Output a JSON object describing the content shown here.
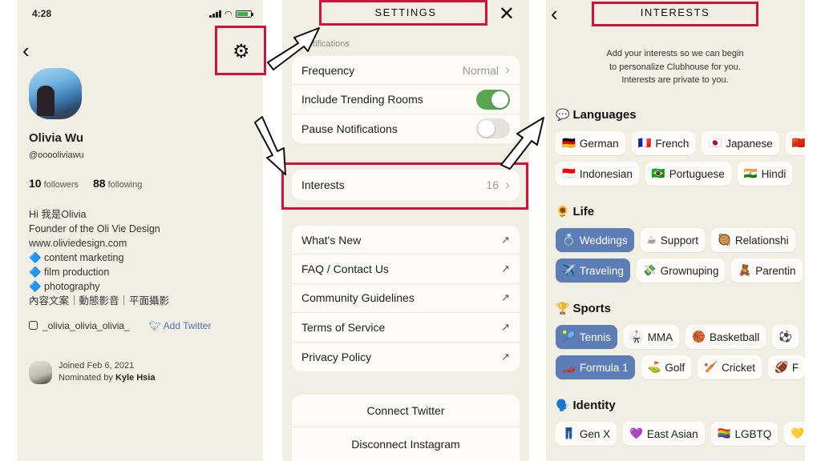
{
  "profile": {
    "status_time": "4:28",
    "name": "Olivia Wu",
    "handle": "@ooooliviawu",
    "followers_count": "10",
    "followers_label": "followers",
    "following_count": "88",
    "following_label": "following",
    "bio": [
      "Hi 我是Olivia",
      "Founder of the Oli Vie Design",
      "www.oliviedesign.com",
      "🔷 content marketing",
      "🔷 film production",
      "🔷 photography",
      "內容文案｜動態影音｜平面攝影"
    ],
    "instagram": "_olivia_olivia_olivia_",
    "add_twitter": "Add Twitter",
    "joined": "Joined Feb 6, 2021",
    "nominated_prefix": "Nominated by",
    "nominated_by": "Kyle Hsia"
  },
  "settings": {
    "title": "SETTINGS",
    "notifications_label": "Notifications",
    "frequency_label": "Frequency",
    "frequency_value": "Normal",
    "trending_label": "Include Trending Rooms",
    "trending_on": true,
    "pause_label": "Pause Notifications",
    "pause_on": false,
    "interests_label": "Interests",
    "interests_count": "16",
    "links": [
      "What's New",
      "FAQ / Contact Us",
      "Community Guidelines",
      "Terms of Service",
      "Privacy Policy"
    ],
    "connect_twitter": "Connect Twitter",
    "disconnect_instagram": "Disconnect Instagram"
  },
  "interests": {
    "title": "INTERESTS",
    "intro": [
      "Add your interests so we can begin",
      "to personalize Clubhouse for you.",
      "Interests are private to you."
    ],
    "categories": [
      {
        "emoji": "💬",
        "name": "Languages",
        "rows": [
          [
            {
              "e": "🇩🇪",
              "t": "German",
              "sel": false
            },
            {
              "e": "🇫🇷",
              "t": "French",
              "sel": false
            },
            {
              "e": "🇯🇵",
              "t": "Japanese",
              "sel": false
            },
            {
              "e": "🇨🇳",
              "t": "",
              "sel": false
            }
          ],
          [
            {
              "e": "🇮🇩",
              "t": "Indonesian",
              "sel": false
            },
            {
              "e": "🇧🇷",
              "t": "Portuguese",
              "sel": false
            },
            {
              "e": "🇮🇳",
              "t": "Hindi",
              "sel": false
            }
          ]
        ]
      },
      {
        "emoji": "🌻",
        "name": "Life",
        "rows": [
          [
            {
              "e": "💍",
              "t": "Weddings",
              "sel": true
            },
            {
              "e": "☕",
              "t": "Support",
              "sel": false
            },
            {
              "e": "🥘",
              "t": "Relationshi",
              "sel": false
            }
          ],
          [
            {
              "e": "✈️",
              "t": "Traveling",
              "sel": true
            },
            {
              "e": "💸",
              "t": "Grownuping",
              "sel": false
            },
            {
              "e": "🧸",
              "t": "Parentin",
              "sel": false
            }
          ]
        ]
      },
      {
        "emoji": "🏆",
        "name": "Sports",
        "rows": [
          [
            {
              "e": "🎾",
              "t": "Tennis",
              "sel": true
            },
            {
              "e": "🥋",
              "t": "MMA",
              "sel": false
            },
            {
              "e": "🏀",
              "t": "Basketball",
              "sel": false
            },
            {
              "e": "⚽",
              "t": "",
              "sel": false
            }
          ],
          [
            {
              "e": "🏎️",
              "t": "Formula 1",
              "sel": true
            },
            {
              "e": "⛳",
              "t": "Golf",
              "sel": false
            },
            {
              "e": "🏏",
              "t": "Cricket",
              "sel": false
            },
            {
              "e": "🏈",
              "t": "F",
              "sel": false
            }
          ]
        ]
      },
      {
        "emoji": "🗣️",
        "name": "Identity",
        "rows": [
          [
            {
              "e": "👖",
              "t": "Gen X",
              "sel": false
            },
            {
              "e": "💜",
              "t": "East Asian",
              "sel": false
            },
            {
              "e": "🏳️‍🌈",
              "t": "LGBTQ",
              "sel": false
            },
            {
              "e": "💛",
              "t": "",
              "sel": false
            }
          ]
        ]
      }
    ]
  },
  "colors": {
    "panel_bg": "#f1efe4",
    "highlight": "#d0133c",
    "toggle_on": "#5aa552",
    "chip_selected": "#5d7db6",
    "link_blue": "#4a74b6"
  }
}
